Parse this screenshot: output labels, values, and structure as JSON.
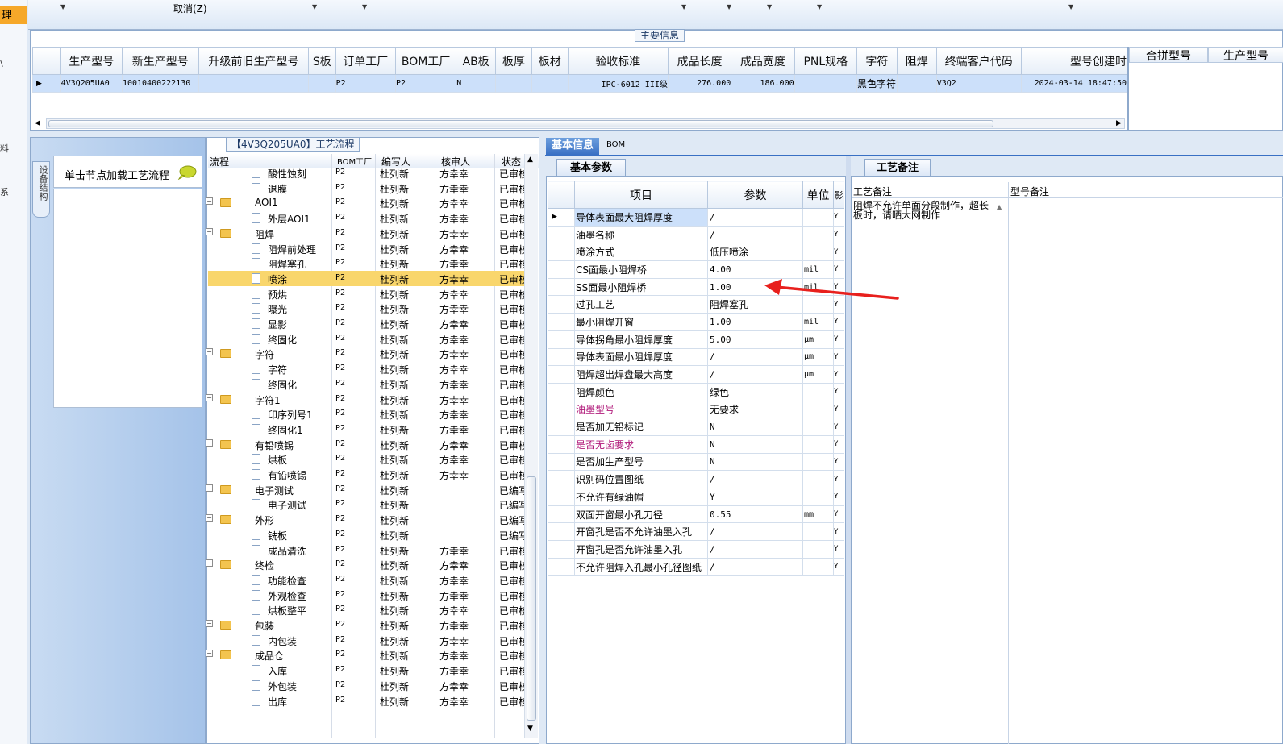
{
  "toolbar": {
    "cancel_label": "取消(Z)"
  },
  "left_strip": {
    "selected_label": "理",
    "items": [
      "\\",
      "料",
      "系"
    ]
  },
  "main_info": {
    "tab_label": "主要信息",
    "columns": [
      "生产型号",
      "新生产型号",
      "升级前旧生产型号",
      "S板",
      "订单工厂",
      "BOM工厂",
      "AB板",
      "板厚",
      "板材",
      "验收标准",
      "成品长度",
      "成品宽度",
      "PNL规格",
      "字符",
      "阻焊",
      "终端客户代码",
      "型号创建时"
    ],
    "right_columns": [
      "合拼型号",
      "生产型号"
    ],
    "row": {
      "col_0": "4V3Q205UA0",
      "col_1": "10010400222130",
      "col_2": "",
      "col_3": "",
      "col_4": "P2",
      "col_5": "P2",
      "col_6": "N",
      "col_7": "",
      "col_8": "",
      "col_9": "IPC-6012 III级",
      "col_10": "276.000",
      "col_11": "186.000",
      "col_12": "",
      "col_13": "黑色字符",
      "col_14": "",
      "col_15": "V3Q2",
      "col_16": "2024-03-14 18:47:50"
    }
  },
  "device_panel": {
    "tab_label": "设备结构",
    "hint": "单击节点加载工艺流程"
  },
  "process_tree": {
    "title": "【4V3Q205UA0】工艺流程",
    "headers": [
      "流程",
      "BOM工厂",
      "编写人",
      "核审人",
      "状态"
    ],
    "rows": [
      {
        "name": "酸性蚀刻",
        "level": 2,
        "bom": "P2",
        "writer": "杜列新",
        "reviewer": "方幸幸",
        "status": "已审核"
      },
      {
        "name": "退膜",
        "level": 2,
        "bom": "P2",
        "writer": "杜列新",
        "reviewer": "方幸幸",
        "status": "已审核"
      },
      {
        "name": "AOI1",
        "level": 1,
        "bom": "P2",
        "writer": "杜列新",
        "reviewer": "方幸幸",
        "status": "已审核"
      },
      {
        "name": "外层AOI1",
        "level": 2,
        "bom": "P2",
        "writer": "杜列新",
        "reviewer": "方幸幸",
        "status": "已审核"
      },
      {
        "name": "阻焊",
        "level": 1,
        "bom": "P2",
        "writer": "杜列新",
        "reviewer": "方幸幸",
        "status": "已审核"
      },
      {
        "name": "阻焊前处理",
        "level": 2,
        "bom": "P2",
        "writer": "杜列新",
        "reviewer": "方幸幸",
        "status": "已审核"
      },
      {
        "name": "阻焊塞孔",
        "level": 2,
        "bom": "P2",
        "writer": "杜列新",
        "reviewer": "方幸幸",
        "status": "已审核"
      },
      {
        "name": "喷涂",
        "level": 2,
        "bom": "P2",
        "writer": "杜列新",
        "reviewer": "方幸幸",
        "status": "已审核"
      },
      {
        "name": "预烘",
        "level": 2,
        "bom": "P2",
        "writer": "杜列新",
        "reviewer": "方幸幸",
        "status": "已审核"
      },
      {
        "name": "曝光",
        "level": 2,
        "bom": "P2",
        "writer": "杜列新",
        "reviewer": "方幸幸",
        "status": "已审核"
      },
      {
        "name": "显影",
        "level": 2,
        "bom": "P2",
        "writer": "杜列新",
        "reviewer": "方幸幸",
        "status": "已审核"
      },
      {
        "name": "终固化",
        "level": 2,
        "bom": "P2",
        "writer": "杜列新",
        "reviewer": "方幸幸",
        "status": "已审核"
      },
      {
        "name": "字符",
        "level": 1,
        "bom": "P2",
        "writer": "杜列新",
        "reviewer": "方幸幸",
        "status": "已审核"
      },
      {
        "name": "字符",
        "level": 2,
        "bom": "P2",
        "writer": "杜列新",
        "reviewer": "方幸幸",
        "status": "已审核"
      },
      {
        "name": "终固化",
        "level": 2,
        "bom": "P2",
        "writer": "杜列新",
        "reviewer": "方幸幸",
        "status": "已审核"
      },
      {
        "name": "字符1",
        "level": 1,
        "bom": "P2",
        "writer": "杜列新",
        "reviewer": "方幸幸",
        "status": "已审核"
      },
      {
        "name": "印序列号1",
        "level": 2,
        "bom": "P2",
        "writer": "杜列新",
        "reviewer": "方幸幸",
        "status": "已审核"
      },
      {
        "name": "终固化1",
        "level": 2,
        "bom": "P2",
        "writer": "杜列新",
        "reviewer": "方幸幸",
        "status": "已审核"
      },
      {
        "name": "有铅喷锡",
        "level": 1,
        "bom": "P2",
        "writer": "杜列新",
        "reviewer": "方幸幸",
        "status": "已审核"
      },
      {
        "name": "烘板",
        "level": 2,
        "bom": "P2",
        "writer": "杜列新",
        "reviewer": "方幸幸",
        "status": "已审核"
      },
      {
        "name": "有铅喷锡",
        "level": 2,
        "bom": "P2",
        "writer": "杜列新",
        "reviewer": "方幸幸",
        "status": "已审核"
      },
      {
        "name": "电子测试",
        "level": 1,
        "bom": "P2",
        "writer": "杜列新",
        "reviewer": "",
        "status": "已编写"
      },
      {
        "name": "电子测试",
        "level": 2,
        "bom": "P2",
        "writer": "杜列新",
        "reviewer": "",
        "status": "已编写"
      },
      {
        "name": "外形",
        "level": 1,
        "bom": "P2",
        "writer": "杜列新",
        "reviewer": "",
        "status": "已编写"
      },
      {
        "name": "铣板",
        "level": 2,
        "bom": "P2",
        "writer": "杜列新",
        "reviewer": "",
        "status": "已编写"
      },
      {
        "name": "成品清洗",
        "level": 2,
        "bom": "P2",
        "writer": "杜列新",
        "reviewer": "方幸幸",
        "status": "已审核"
      },
      {
        "name": "终检",
        "level": 1,
        "bom": "P2",
        "writer": "杜列新",
        "reviewer": "方幸幸",
        "status": "已审核"
      },
      {
        "name": "功能检查",
        "level": 2,
        "bom": "P2",
        "writer": "杜列新",
        "reviewer": "方幸幸",
        "status": "已审核"
      },
      {
        "name": "外观检查",
        "level": 2,
        "bom": "P2",
        "writer": "杜列新",
        "reviewer": "方幸幸",
        "status": "已审核"
      },
      {
        "name": "烘板整平",
        "level": 2,
        "bom": "P2",
        "writer": "杜列新",
        "reviewer": "方幸幸",
        "status": "已审核"
      },
      {
        "name": "包装",
        "level": 1,
        "bom": "P2",
        "writer": "杜列新",
        "reviewer": "方幸幸",
        "status": "已审核"
      },
      {
        "name": "内包装",
        "level": 2,
        "bom": "P2",
        "writer": "杜列新",
        "reviewer": "方幸幸",
        "status": "已审核"
      },
      {
        "name": "成品仓",
        "level": 1,
        "bom": "P2",
        "writer": "杜列新",
        "reviewer": "方幸幸",
        "status": "已审核"
      },
      {
        "name": "入库",
        "level": 2,
        "bom": "P2",
        "writer": "杜列新",
        "reviewer": "方幸幸",
        "status": "已审核"
      },
      {
        "name": "外包装",
        "level": 2,
        "bom": "P2",
        "writer": "杜列新",
        "reviewer": "方幸幸",
        "status": "已审核"
      },
      {
        "name": "出库",
        "level": 2,
        "bom": "P2",
        "writer": "杜列新",
        "reviewer": "方幸幸",
        "status": "已审核"
      }
    ]
  },
  "right_tabs": {
    "basic_info": "基本信息",
    "bom": "BOM"
  },
  "basic_params": {
    "tab_label": "基本参数",
    "headers": [
      "项目",
      "参数",
      "单位",
      "影"
    ],
    "rows": [
      {
        "item": "导体表面最大阻焊厚度",
        "value": "/",
        "unit": "",
        "flag": "Y",
        "pink": false
      },
      {
        "item": "油墨名称",
        "value": "/",
        "unit": "",
        "flag": "Y",
        "pink": false
      },
      {
        "item": "喷涂方式",
        "value": "低压喷涂",
        "unit": "",
        "flag": "Y",
        "pink": false
      },
      {
        "item": "CS面最小阻焊桥",
        "value": "4.00",
        "unit": "mil",
        "flag": "Y",
        "pink": false
      },
      {
        "item": "SS面最小阻焊桥",
        "value": "1.00",
        "unit": "mil",
        "flag": "Y",
        "pink": false
      },
      {
        "item": "过孔工艺",
        "value": "阻焊塞孔",
        "unit": "",
        "flag": "Y",
        "pink": false
      },
      {
        "item": "最小阻焊开窗",
        "value": "1.00",
        "unit": "mil",
        "flag": "Y",
        "pink": false
      },
      {
        "item": "导体拐角最小阻焊厚度",
        "value": "5.00",
        "unit": "μm",
        "flag": "Y",
        "pink": false
      },
      {
        "item": "导体表面最小阻焊厚度",
        "value": "/",
        "unit": "μm",
        "flag": "Y",
        "pink": false
      },
      {
        "item": "阻焊超出焊盘最大高度",
        "value": "/",
        "unit": "μm",
        "flag": "Y",
        "pink": false
      },
      {
        "item": "阻焊颜色",
        "value": "绿色",
        "unit": "",
        "flag": "Y",
        "pink": false
      },
      {
        "item": "油墨型号",
        "value": "无要求",
        "unit": "",
        "flag": "Y",
        "pink": true
      },
      {
        "item": "是否加无铅标记",
        "value": "N",
        "unit": "",
        "flag": "Y",
        "pink": false
      },
      {
        "item": "是否无卤要求",
        "value": "N",
        "unit": "",
        "flag": "Y",
        "pink": true
      },
      {
        "item": "是否加生产型号",
        "value": "N",
        "unit": "",
        "flag": "Y",
        "pink": false
      },
      {
        "item": "识别码位置图纸",
        "value": "/",
        "unit": "",
        "flag": "Y",
        "pink": false
      },
      {
        "item": "不允许有绿油帽",
        "value": "Y",
        "unit": "",
        "flag": "Y",
        "pink": false
      },
      {
        "item": "双面开窗最小孔刀径",
        "value": "0.55",
        "unit": "mm",
        "flag": "Y",
        "pink": false
      },
      {
        "item": "开窗孔是否不允许油墨入孔",
        "value": "/",
        "unit": "",
        "flag": "Y",
        "pink": false
      },
      {
        "item": "开窗孔是否允许油墨入孔",
        "value": "/",
        "unit": "",
        "flag": "Y",
        "pink": false
      },
      {
        "item": "不允许阻焊入孔最小孔径图纸",
        "value": "/",
        "unit": "",
        "flag": "Y",
        "pink": false
      }
    ]
  },
  "notes": {
    "tab_label": "工艺备注",
    "process_note_header": "工艺备注",
    "model_note_header": "型号备注",
    "process_note_text": "阻焊不允许单面分段制作，超长板时，请晒大网制作"
  },
  "colors": {
    "selection": "#cce0fa",
    "highlight_row": "#f9d66c",
    "tab_active": "#3970c4",
    "annotation_arrow": "#e8201d",
    "pink_text": "#b0197a"
  }
}
